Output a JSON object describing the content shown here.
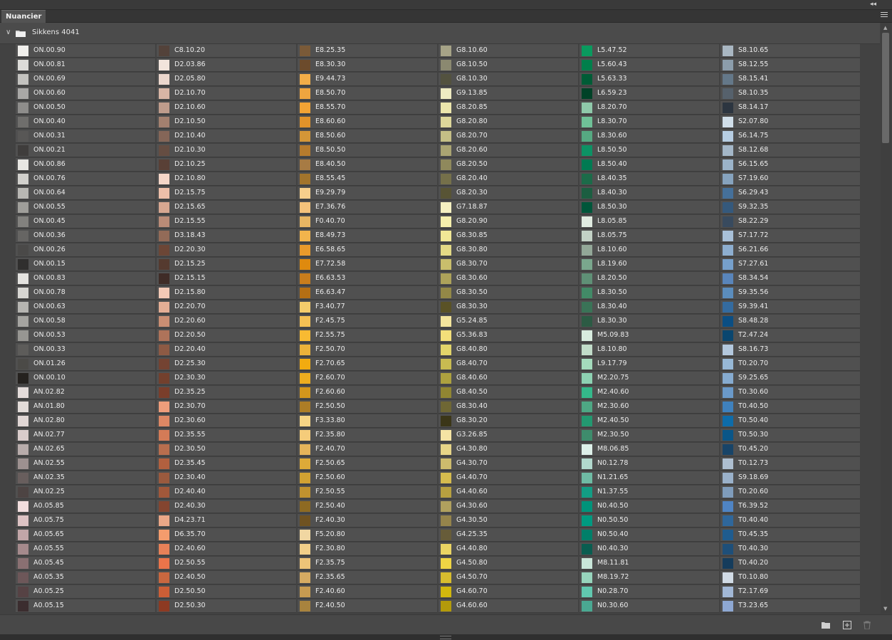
{
  "panel": {
    "tab_label": "Nuancier"
  },
  "group": {
    "name": "Sikkens 4041"
  },
  "icons": {
    "collapse": "double-chevron-left-icon",
    "menu": "hamburger-menu-icon",
    "expand": "chevron-down-icon",
    "folder": "folder-icon",
    "new_group": "new-folder-icon",
    "new_swatch": "add-swatch-icon",
    "delete": "trash-icon"
  },
  "columns": [
    [
      {
        "name": "ON.00.90",
        "color": "#f0efec"
      },
      {
        "name": "ON.00.81",
        "color": "#dddcd9"
      },
      {
        "name": "ON.00.69",
        "color": "#c3c2bf"
      },
      {
        "name": "ON.00.60",
        "color": "#a9a8a6"
      },
      {
        "name": "ON.00.50",
        "color": "#8e8d8b"
      },
      {
        "name": "ON.00.40",
        "color": "#6f6e6c"
      },
      {
        "name": "ON.00.31",
        "color": "#585756"
      },
      {
        "name": "ON.00.21",
        "color": "#3f3d3c"
      },
      {
        "name": "ON.00.86",
        "color": "#e8e7e3"
      },
      {
        "name": "ON.00.76",
        "color": "#d1d0cc"
      },
      {
        "name": "ON.00.64",
        "color": "#b8b7b3"
      },
      {
        "name": "ON.00.55",
        "color": "#9f9e9a"
      },
      {
        "name": "ON.00.45",
        "color": "#82817e"
      },
      {
        "name": "ON.00.36",
        "color": "#666563"
      },
      {
        "name": "ON.00.26",
        "color": "#4a4948"
      },
      {
        "name": "ON.00.15",
        "color": "#302f2e"
      },
      {
        "name": "ON.00.83",
        "color": "#e3e2df"
      },
      {
        "name": "ON.00.78",
        "color": "#d7d6d2"
      },
      {
        "name": "ON.00.63",
        "color": "#b6b5b1"
      },
      {
        "name": "ON.00.58",
        "color": "#a5a4a0"
      },
      {
        "name": "ON.00.53",
        "color": "#979692"
      },
      {
        "name": "ON.00.33",
        "color": "#5d5c5a"
      },
      {
        "name": "ON.01.26",
        "color": "#4b4a47"
      },
      {
        "name": "ON.00.10",
        "color": "#25221f"
      },
      {
        "name": "AN.02.82",
        "color": "#e4dcda"
      },
      {
        "name": "AN.01.80",
        "color": "#e2dbd8"
      },
      {
        "name": "AN.02.80",
        "color": "#e0d6d4"
      },
      {
        "name": "AN.02.77",
        "color": "#d9cccb"
      },
      {
        "name": "AN.02.65",
        "color": "#b8acab"
      },
      {
        "name": "AN.02.55",
        "color": "#9d9190"
      },
      {
        "name": "AN.02.35",
        "color": "#685e5d"
      },
      {
        "name": "AN.02.25",
        "color": "#4d4443"
      },
      {
        "name": "A0.05.85",
        "color": "#f2dede"
      },
      {
        "name": "A0.05.75",
        "color": "#dcc2c3"
      },
      {
        "name": "A0.05.65",
        "color": "#c2a6a8"
      },
      {
        "name": "A0.05.55",
        "color": "#a58a8c"
      },
      {
        "name": "A0.05.45",
        "color": "#8a7072"
      },
      {
        "name": "A0.05.35",
        "color": "#6d5759"
      },
      {
        "name": "A0.05.25",
        "color": "#564244"
      },
      {
        "name": "A0.05.15",
        "color": "#3b2d2f"
      }
    ],
    [
      {
        "name": "C8.10.20",
        "color": "#53423a"
      },
      {
        "name": "D2.03.86",
        "color": "#f2e4dc"
      },
      {
        "name": "D2.05.80",
        "color": "#ecd7cd"
      },
      {
        "name": "D2.10.70",
        "color": "#d8b5a5"
      },
      {
        "name": "D2.10.60",
        "color": "#bf9c8c"
      },
      {
        "name": "D2.10.50",
        "color": "#a3806f"
      },
      {
        "name": "D2.10.40",
        "color": "#856658"
      },
      {
        "name": "D2.10.30",
        "color": "#654d42"
      },
      {
        "name": "D2.10.25",
        "color": "#594036"
      },
      {
        "name": "D2.10.80",
        "color": "#f4d6c8"
      },
      {
        "name": "D2.15.75",
        "color": "#eebfa9"
      },
      {
        "name": "D2.15.65",
        "color": "#d7a791"
      },
      {
        "name": "D2.15.55",
        "color": "#b98b77"
      },
      {
        "name": "D3.18.43",
        "color": "#936b58"
      },
      {
        "name": "D2.20.30",
        "color": "#6c4636"
      },
      {
        "name": "D2.15.25",
        "color": "#553a2f"
      },
      {
        "name": "D2.15.15",
        "color": "#3f2c27"
      },
      {
        "name": "D2.15.80",
        "color": "#f3c9b6"
      },
      {
        "name": "D2.20.70",
        "color": "#e4ae95"
      },
      {
        "name": "D2.20.60",
        "color": "#c98e73"
      },
      {
        "name": "D2.20.50",
        "color": "#ae735a"
      },
      {
        "name": "D2.20.40",
        "color": "#8d5a44"
      },
      {
        "name": "D2.25.30",
        "color": "#744332"
      },
      {
        "name": "D2.30.30",
        "color": "#73402d"
      },
      {
        "name": "D2.35.25",
        "color": "#7a3e2b"
      },
      {
        "name": "D2.30.70",
        "color": "#ee9d7b"
      },
      {
        "name": "D2.30.60",
        "color": "#dc8764"
      },
      {
        "name": "D2.35.55",
        "color": "#d47b57"
      },
      {
        "name": "D2.30.50",
        "color": "#b86e4e"
      },
      {
        "name": "D2.35.45",
        "color": "#b2603f"
      },
      {
        "name": "D2.30.40",
        "color": "#9b5a3e"
      },
      {
        "name": "D2.40.40",
        "color": "#a2583a"
      },
      {
        "name": "D2.40.30",
        "color": "#844530"
      },
      {
        "name": "D4.23.71",
        "color": "#eba787"
      },
      {
        "name": "D6.35.70",
        "color": "#f49c6d"
      },
      {
        "name": "D2.40.60",
        "color": "#e78158"
      },
      {
        "name": "D2.50.55",
        "color": "#ea744a"
      },
      {
        "name": "D2.40.50",
        "color": "#c9673f"
      },
      {
        "name": "D2.50.50",
        "color": "#cc5e36"
      },
      {
        "name": "D2.50.30",
        "color": "#8d3a22"
      }
    ],
    [
      {
        "name": "E8.25.35",
        "color": "#7a5a38"
      },
      {
        "name": "E8.30.30",
        "color": "#6c4b2c"
      },
      {
        "name": "E9.44.73",
        "color": "#f2ad48"
      },
      {
        "name": "E8.50.70",
        "color": "#efa53f"
      },
      {
        "name": "E8.55.70",
        "color": "#f2a334"
      },
      {
        "name": "E8.60.60",
        "color": "#e0922a"
      },
      {
        "name": "E8.50.60",
        "color": "#d49637"
      },
      {
        "name": "E8.50.50",
        "color": "#b67b2d"
      },
      {
        "name": "E8.40.50",
        "color": "#a77b44"
      },
      {
        "name": "E8.55.45",
        "color": "#a2742c"
      },
      {
        "name": "E9.29.79",
        "color": "#f7cf8c"
      },
      {
        "name": "E7.36.76",
        "color": "#f4c27b"
      },
      {
        "name": "F0.40.70",
        "color": "#e6b563"
      },
      {
        "name": "E8.49.73",
        "color": "#f2b44c"
      },
      {
        "name": "E6.58.65",
        "color": "#e99a2b"
      },
      {
        "name": "E7.72.58",
        "color": "#df8a0e"
      },
      {
        "name": "E6.63.53",
        "color": "#c97d1c"
      },
      {
        "name": "E6.63.47",
        "color": "#b56f14"
      },
      {
        "name": "F3.40.77",
        "color": "#f5cc6b"
      },
      {
        "name": "F2.45.75",
        "color": "#f4c054"
      },
      {
        "name": "F2.55.75",
        "color": "#f8ba32"
      },
      {
        "name": "F2.50.70",
        "color": "#ebb23a"
      },
      {
        "name": "F2.70.65",
        "color": "#f2ab10"
      },
      {
        "name": "F2.60.70",
        "color": "#edad1f"
      },
      {
        "name": "F2.60.60",
        "color": "#d3961c"
      },
      {
        "name": "F2.50.50",
        "color": "#ad7d26"
      },
      {
        "name": "F3.33.80",
        "color": "#f6d485"
      },
      {
        "name": "F2.35.80",
        "color": "#f5cc7a"
      },
      {
        "name": "F2.40.70",
        "color": "#e5b45a"
      },
      {
        "name": "F2.50.65",
        "color": "#ddaa38"
      },
      {
        "name": "F2.50.60",
        "color": "#d2a232"
      },
      {
        "name": "F2.50.55",
        "color": "#c0922f"
      },
      {
        "name": "F2.50.40",
        "color": "#8e6a22"
      },
      {
        "name": "F2.40.30",
        "color": "#6f5221"
      },
      {
        "name": "F5.20.80",
        "color": "#f1d7a2"
      },
      {
        "name": "F2.30.80",
        "color": "#f2cf89"
      },
      {
        "name": "F2.35.75",
        "color": "#eec478"
      },
      {
        "name": "F2.35.65",
        "color": "#d6ab62"
      },
      {
        "name": "F2.40.60",
        "color": "#c79b51"
      },
      {
        "name": "F2.40.50",
        "color": "#a8833e"
      }
    ],
    [
      {
        "name": "G8.10.60",
        "color": "#a6a387"
      },
      {
        "name": "G8.10.50",
        "color": "#8b8970"
      },
      {
        "name": "G8.10.30",
        "color": "#53523f"
      },
      {
        "name": "G9.13.85",
        "color": "#eeebc2"
      },
      {
        "name": "G8.20.85",
        "color": "#ece6ac"
      },
      {
        "name": "G8.20.80",
        "color": "#ddd79a"
      },
      {
        "name": "G8.20.70",
        "color": "#c5bf86"
      },
      {
        "name": "G8.20.60",
        "color": "#aaa472"
      },
      {
        "name": "G8.20.50",
        "color": "#8f895c"
      },
      {
        "name": "G8.20.40",
        "color": "#75704a"
      },
      {
        "name": "G8.20.30",
        "color": "#585435"
      },
      {
        "name": "G7.18.87",
        "color": "#f5f0c1"
      },
      {
        "name": "G8.20.90",
        "color": "#f5efad"
      },
      {
        "name": "G8.30.85",
        "color": "#f0e796"
      },
      {
        "name": "G8.30.80",
        "color": "#e3d985"
      },
      {
        "name": "G8.30.70",
        "color": "#c9be6c"
      },
      {
        "name": "G8.30.60",
        "color": "#ada25a"
      },
      {
        "name": "G8.30.50",
        "color": "#938847"
      },
      {
        "name": "G8.30.30",
        "color": "#5a5226"
      },
      {
        "name": "G5.24.85",
        "color": "#f4e59d"
      },
      {
        "name": "G5.36.83",
        "color": "#f3df7a"
      },
      {
        "name": "G8.40.80",
        "color": "#e2d56a"
      },
      {
        "name": "G8.40.70",
        "color": "#c8bb51"
      },
      {
        "name": "G8.40.60",
        "color": "#ada13f"
      },
      {
        "name": "G8.40.50",
        "color": "#918632"
      },
      {
        "name": "G8.30.40",
        "color": "#6f6734"
      },
      {
        "name": "G8.30.20",
        "color": "#3b3618"
      },
      {
        "name": "G3.26.85",
        "color": "#f5e4a4"
      },
      {
        "name": "G4.30.80",
        "color": "#e7d587"
      },
      {
        "name": "G4.30.70",
        "color": "#cdbb6d"
      },
      {
        "name": "G4.40.70",
        "color": "#d5bb4e"
      },
      {
        "name": "G4.40.60",
        "color": "#b7a040"
      },
      {
        "name": "G4.30.60",
        "color": "#b0a05e"
      },
      {
        "name": "G4.30.50",
        "color": "#95844b"
      },
      {
        "name": "G4.25.35",
        "color": "#675c39"
      },
      {
        "name": "G4.40.80",
        "color": "#ead463"
      },
      {
        "name": "G4.50.80",
        "color": "#efd544"
      },
      {
        "name": "G4.50.70",
        "color": "#d7bc2e"
      },
      {
        "name": "G4.60.70",
        "color": "#d1b70d"
      },
      {
        "name": "G4.60.60",
        "color": "#b39a0b"
      }
    ],
    [
      {
        "name": "L5.47.52",
        "color": "#0a9a5e"
      },
      {
        "name": "L5.60.43",
        "color": "#007f4b"
      },
      {
        "name": "L5.63.33",
        "color": "#005c36"
      },
      {
        "name": "L6.59.23",
        "color": "#004227"
      },
      {
        "name": "L8.20.70",
        "color": "#8fc9aa"
      },
      {
        "name": "L8.30.70",
        "color": "#6fc197"
      },
      {
        "name": "L8.30.60",
        "color": "#56a982"
      },
      {
        "name": "L8.50.50",
        "color": "#0d9264"
      },
      {
        "name": "L8.50.40",
        "color": "#007a52"
      },
      {
        "name": "L8.40.35",
        "color": "#1c6b49"
      },
      {
        "name": "L8.40.30",
        "color": "#1c5e41"
      },
      {
        "name": "L8.50.30",
        "color": "#00563a"
      },
      {
        "name": "L8.05.85",
        "color": "#e0ebe1"
      },
      {
        "name": "L8.05.75",
        "color": "#c3d2c6"
      },
      {
        "name": "L8.10.60",
        "color": "#93a898"
      },
      {
        "name": "L8.19.60",
        "color": "#7aa78d"
      },
      {
        "name": "L8.20.50",
        "color": "#5f9076"
      },
      {
        "name": "L8.30.50",
        "color": "#428a67"
      },
      {
        "name": "L8.30.40",
        "color": "#3a7357"
      },
      {
        "name": "L8.30.30",
        "color": "#2c5b44"
      },
      {
        "name": "M5.09.83",
        "color": "#d8ecdf"
      },
      {
        "name": "L8.10.80",
        "color": "#c1dcc9"
      },
      {
        "name": "L9.17.79",
        "color": "#a4dbbc"
      },
      {
        "name": "M2.20.75",
        "color": "#8dd1b2"
      },
      {
        "name": "M2.40.60",
        "color": "#34b88a"
      },
      {
        "name": "M2.30.60",
        "color": "#4ea784"
      },
      {
        "name": "M2.40.50",
        "color": "#239870"
      },
      {
        "name": "M2.30.50",
        "color": "#3e8c6c"
      },
      {
        "name": "M8.06.85",
        "color": "#def0e9"
      },
      {
        "name": "N0.12.78",
        "color": "#b2d9cd"
      },
      {
        "name": "N1.21.65",
        "color": "#6fbba4"
      },
      {
        "name": "N1.37.55",
        "color": "#139d84"
      },
      {
        "name": "N0.40.50",
        "color": "#00937a"
      },
      {
        "name": "N0.50.50",
        "color": "#009a80"
      },
      {
        "name": "N0.50.40",
        "color": "#007f69"
      },
      {
        "name": "N0.40.30",
        "color": "#0a5d50"
      },
      {
        "name": "M8.11.81",
        "color": "#c9e6d9"
      },
      {
        "name": "M8.19.72",
        "color": "#97d4bc"
      },
      {
        "name": "N0.28.70",
        "color": "#61c8af"
      },
      {
        "name": "N0.30.60",
        "color": "#4aa892"
      }
    ],
    [
      {
        "name": "S8.10.65",
        "color": "#a9b7c2"
      },
      {
        "name": "S8.12.55",
        "color": "#8c9dab"
      },
      {
        "name": "S8.15.41",
        "color": "#647889"
      },
      {
        "name": "S8.10.35",
        "color": "#56616c"
      },
      {
        "name": "S8.14.17",
        "color": "#2c3540"
      },
      {
        "name": "S2.07.80",
        "color": "#d0dee9"
      },
      {
        "name": "S6.14.75",
        "color": "#b6cde2"
      },
      {
        "name": "S8.12.68",
        "color": "#a4b7c8"
      },
      {
        "name": "S6.15.65",
        "color": "#9bb3c9"
      },
      {
        "name": "S7.19.60",
        "color": "#86a3be"
      },
      {
        "name": "S6.29.43",
        "color": "#45709a"
      },
      {
        "name": "S9.32.35",
        "color": "#35597c"
      },
      {
        "name": "S8.22.29",
        "color": "#384a5e"
      },
      {
        "name": "S7.17.72",
        "color": "#a8c0d8"
      },
      {
        "name": "S6.21.66",
        "color": "#8daed0"
      },
      {
        "name": "S7.27.61",
        "color": "#76a0cc"
      },
      {
        "name": "S8.34.54",
        "color": "#5985bb"
      },
      {
        "name": "S9.35.56",
        "color": "#5b8dbd"
      },
      {
        "name": "S9.39.41",
        "color": "#346b9f"
      },
      {
        "name": "S8.48.28",
        "color": "#0b4e83"
      },
      {
        "name": "T2.47.24",
        "color": "#0a466f"
      },
      {
        "name": "S8.16.73",
        "color": "#b3c8de"
      },
      {
        "name": "T0.20.70",
        "color": "#97b8d6"
      },
      {
        "name": "S9.25.65",
        "color": "#86abd0"
      },
      {
        "name": "T0.30.60",
        "color": "#6a99c9"
      },
      {
        "name": "T0.40.50",
        "color": "#3f81bd"
      },
      {
        "name": "T0.50.40",
        "color": "#0e6ca9"
      },
      {
        "name": "T0.50.30",
        "color": "#0a5688"
      },
      {
        "name": "T0.45.20",
        "color": "#184468"
      },
      {
        "name": "T0.12.73",
        "color": "#aebfd0"
      },
      {
        "name": "S9.18.69",
        "color": "#9ab1ca"
      },
      {
        "name": "T0.20.60",
        "color": "#7f9cbb"
      },
      {
        "name": "T6.39.52",
        "color": "#4f84c4"
      },
      {
        "name": "T0.40.40",
        "color": "#2f679b"
      },
      {
        "name": "T0.45.35",
        "color": "#1f5c8f"
      },
      {
        "name": "T0.40.30",
        "color": "#1e4f79"
      },
      {
        "name": "T0.40.20",
        "color": "#153c5c"
      },
      {
        "name": "T0.10.80",
        "color": "#d1dbe5"
      },
      {
        "name": "T2.17.69",
        "color": "#a2b8d6"
      },
      {
        "name": "T3.23.65",
        "color": "#8ea8d3"
      }
    ]
  ]
}
